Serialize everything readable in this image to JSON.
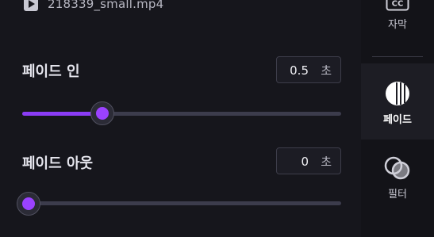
{
  "file": {
    "name": "218339_small.mp4",
    "icon": "play-file-icon"
  },
  "fade_in": {
    "label": "페이드 인",
    "value": "0.5",
    "unit": "초",
    "slider_fraction": 0.25
  },
  "fade_out": {
    "label": "페이드 아웃",
    "value": "0",
    "unit": "초",
    "slider_fraction": 0.0
  },
  "sidebar": {
    "items": [
      {
        "label": "자막",
        "icon": "cc-icon",
        "active": false
      },
      {
        "label": "페이드",
        "icon": "fade-icon",
        "active": true
      },
      {
        "label": "필터",
        "icon": "filter-icon",
        "active": false
      }
    ]
  },
  "colors": {
    "accent": "#8b3cf6",
    "background": "#16161c",
    "sidebar": "#131318"
  }
}
